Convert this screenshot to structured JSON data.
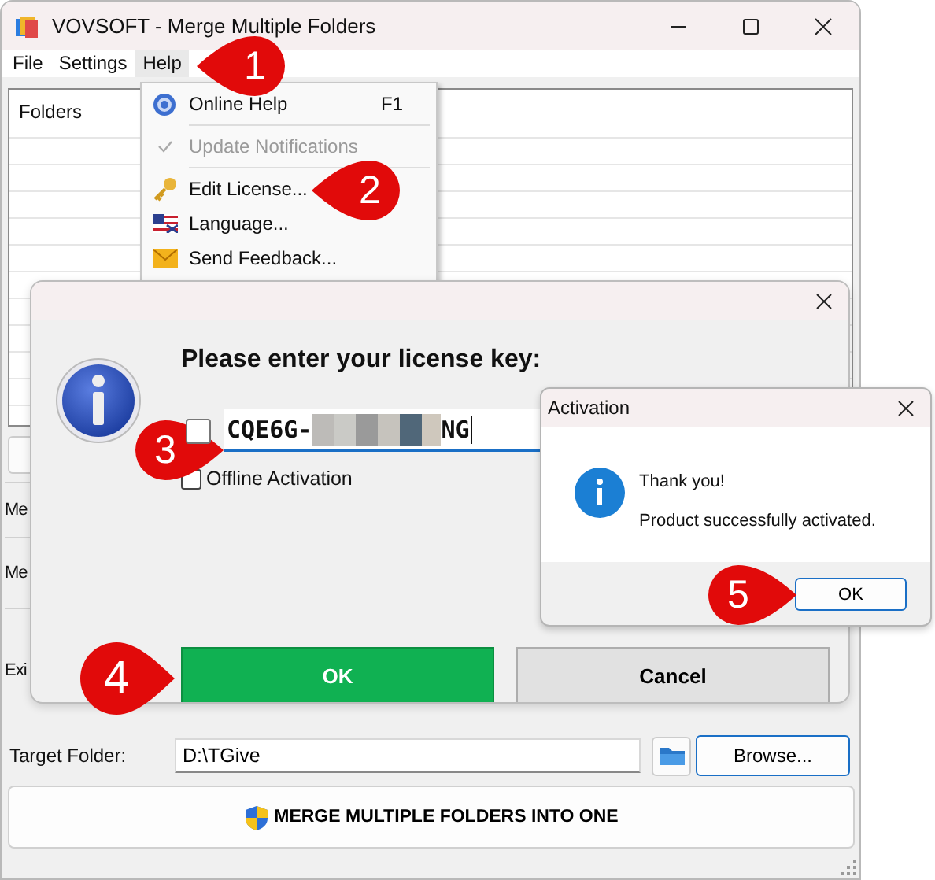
{
  "window": {
    "title": "VOVSOFT - Merge Multiple Folders"
  },
  "menu": [
    {
      "label": "File",
      "selected": false
    },
    {
      "label": "Settings",
      "selected": false
    },
    {
      "label": "Help",
      "selected": true
    }
  ],
  "help_menu": [
    {
      "kind": "help",
      "label": "Online Help",
      "shortcut": "F1",
      "checked": false,
      "disabled": false
    },
    {
      "kind": "separator"
    },
    {
      "kind": "plain",
      "label": "Update Notifications",
      "checked": true,
      "disabled": true
    },
    {
      "kind": "separator"
    },
    {
      "kind": "key",
      "label": "Edit License...",
      "checked": false,
      "disabled": false
    },
    {
      "kind": "flag",
      "label": "Language...",
      "checked": false,
      "disabled": false
    },
    {
      "kind": "mail",
      "label": "Send Feedback...",
      "checked": false,
      "disabled": false
    }
  ],
  "folders_list": {
    "header": "Folders"
  },
  "side_labels": [
    "Me",
    "Me",
    "Exi"
  ],
  "target_folder": {
    "label": "Target Folder:",
    "value": "D:\\TGive",
    "browse": "Browse..."
  },
  "merge_button": "MERGE MULTIPLE FOLDERS INTO ONE",
  "license_dialog": {
    "heading": "Please enter your license key:",
    "key_box": {
      "checked": false
    },
    "key_start": "CQE6G-",
    "key_end": "NG",
    "offline_activation": {
      "label": "Offline Activation",
      "checked": false
    },
    "buttons": [
      {
        "label": "OK",
        "kind": "primary"
      },
      {
        "label": "Cancel",
        "kind": "secondary"
      }
    ]
  },
  "activation_dialog": {
    "title": "Activation",
    "lines": [
      "Thank you!",
      "Product successfully activated."
    ],
    "button": "OK"
  },
  "steps": [
    "1",
    "2",
    "3",
    "4",
    "5"
  ]
}
